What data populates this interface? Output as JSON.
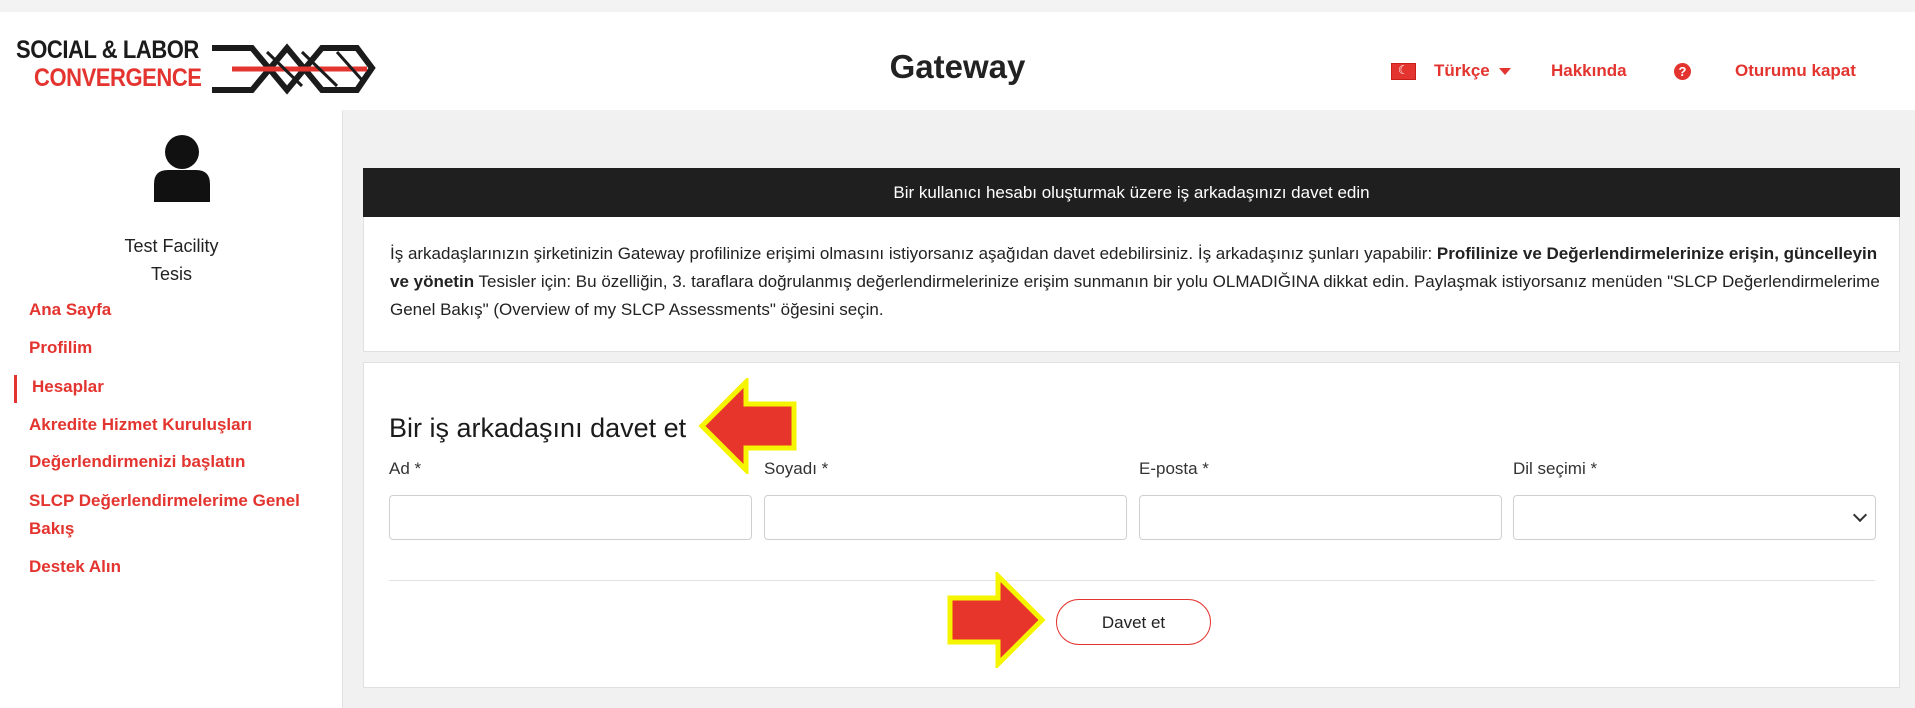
{
  "header": {
    "logo_line1": "SOCIAL & LABOR",
    "logo_line2": "CONVERGENCE",
    "title": "Gateway",
    "language": "Türkçe",
    "about": "Hakkında",
    "help_icon": "?",
    "logout": "Oturumu kapat"
  },
  "sidebar": {
    "user_name": "Test Facility",
    "user_role": "Tesis",
    "items": [
      {
        "label": "Ana Sayfa"
      },
      {
        "label": "Profilim"
      },
      {
        "label": "Hesaplar"
      },
      {
        "label": "Akredite Hizmet Kuruluşları"
      },
      {
        "label": "Değerlendirmenizi başlatın"
      },
      {
        "label": "SLCP Değerlendirmelerime Genel"
      },
      {
        "label": "Bakış"
      },
      {
        "label": "Destek Alın"
      }
    ]
  },
  "banner": {
    "text": "Bir kullanıcı hesabı oluşturmak üzere iş arkadaşınızı davet edin"
  },
  "info": {
    "part1": "İş arkadaşlarınızın şirketinizin Gateway profilinize erişimi olmasını istiyorsanız aşağıdan davet edebilirsiniz. İş arkadaşınız şunları yapabilir: ",
    "bold": "Profilinize ve Değerlendirmelerinize erişin, güncelleyin ve yönetin",
    "part2": " Tesisler için: Bu özelliğin, 3. taraflara doğrulanmış değerlendirmelerinize erişim sunmanın bir yolu OLMADIĞINA dikkat edin. Paylaşmak istiyorsanız menüden \"SLCP Değerlendirmelerime Genel Bakış\" (Overview of my SLCP Assessments\" öğesini seçin."
  },
  "form": {
    "title": "Bir iş arkadaşını davet et",
    "first_name_label": "Ad *",
    "last_name_label": "Soyadı *",
    "email_label": "E-posta *",
    "language_label": "Dil seçimi *",
    "first_name_value": "",
    "last_name_value": "",
    "email_value": "",
    "language_value": "",
    "submit": "Davet et"
  },
  "colors": {
    "accent": "#e3342f",
    "banner_bg": "#1f1f1f",
    "annotation_arrow": "#e8352c",
    "annotation_outline": "#f5f500"
  }
}
